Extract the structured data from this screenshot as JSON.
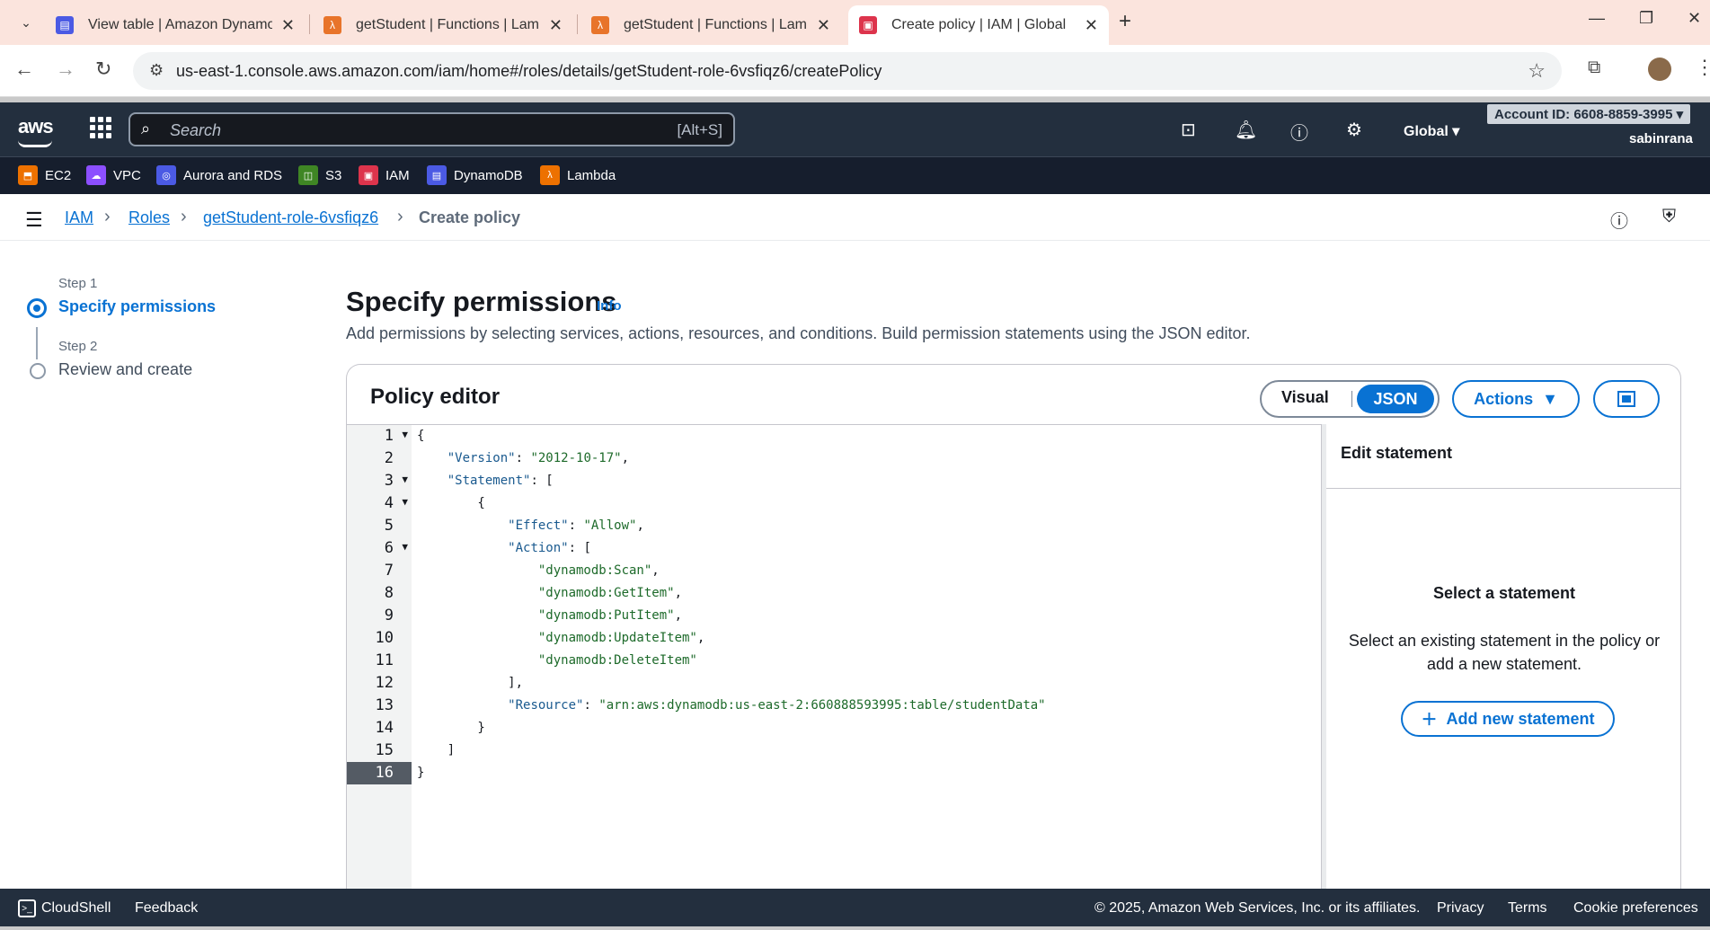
{
  "browser": {
    "tabs": [
      {
        "title": "View table | Amazon DynamoDB",
        "color": "#4b5ae4"
      },
      {
        "title": "getStudent | Functions | Lambda",
        "color": "#e8742a"
      },
      {
        "title": "getStudent | Functions | Lambda",
        "color": "#e8742a"
      },
      {
        "title": "Create policy | IAM | Global",
        "color": "#dd344c"
      }
    ],
    "url": "us-east-1.console.aws.amazon.com/iam/home#/roles/details/getStudent-role-6vsfiqz6/createPolicy"
  },
  "aws_nav": {
    "logo": "aws",
    "search_placeholder": "Search",
    "search_shortcut": "[Alt+S]",
    "region": "Global",
    "account": "Account ID: 6608-8859-3995",
    "username": "sabinrana"
  },
  "favorites": [
    {
      "label": "EC2",
      "color": "#ed7100"
    },
    {
      "label": "VPC",
      "color": "#8c4fff"
    },
    {
      "label": "Aurora and RDS",
      "color": "#4b5ae4"
    },
    {
      "label": "S3",
      "color": "#3f8624"
    },
    {
      "label": "IAM",
      "color": "#dd344c"
    },
    {
      "label": "DynamoDB",
      "color": "#4b5ae4"
    },
    {
      "label": "Lambda",
      "color": "#ed7100"
    }
  ],
  "breadcrumb": {
    "iam": "IAM",
    "roles": "Roles",
    "role": "getStudent-role-6vsfiqz6",
    "current": "Create policy"
  },
  "steps": [
    {
      "label": "Step 1",
      "name": "Specify permissions"
    },
    {
      "label": "Step 2",
      "name": "Review and create"
    }
  ],
  "page": {
    "title": "Specify permissions",
    "info": "Info",
    "description": "Add permissions by selecting services, actions, resources, and conditions. Build permission statements using the JSON editor."
  },
  "editor": {
    "title": "Policy editor",
    "visual_label": "Visual",
    "json_label": "JSON",
    "actions_label": "Actions",
    "active_line": 16,
    "lines": [
      {
        "n": "1",
        "text": "{"
      },
      {
        "n": "2",
        "text": "    \"Version\": \"2012-10-17\","
      },
      {
        "n": "3",
        "text": "    \"Statement\": ["
      },
      {
        "n": "4",
        "text": "        {"
      },
      {
        "n": "5",
        "text": "            \"Effect\": \"Allow\","
      },
      {
        "n": "6",
        "text": "            \"Action\": ["
      },
      {
        "n": "7",
        "text": "                \"dynamodb:Scan\","
      },
      {
        "n": "8",
        "text": "                \"dynamodb:GetItem\","
      },
      {
        "n": "9",
        "text": "                \"dynamodb:PutItem\","
      },
      {
        "n": "10",
        "text": "                \"dynamodb:UpdateItem\","
      },
      {
        "n": "11",
        "text": "                \"dynamodb:DeleteItem\""
      },
      {
        "n": "12",
        "text": "            ],"
      },
      {
        "n": "13",
        "text": "            \"Resource\": \"arn:aws:dynamodb:us-east-2:660888593995:table/studentData\""
      },
      {
        "n": "14",
        "text": "        }"
      },
      {
        "n": "15",
        "text": "    ]"
      },
      {
        "n": "16",
        "text": "}"
      }
    ]
  },
  "side_panel": {
    "title": "Edit statement",
    "select_title": "Select a statement",
    "select_text": "Select an existing statement in the policy or add a new statement.",
    "add_label": "Add new statement"
  },
  "footer": {
    "cloudshell": "CloudShell",
    "feedback": "Feedback",
    "copyright": "© 2025, Amazon Web Services, Inc. or its affiliates.",
    "privacy": "Privacy",
    "terms": "Terms",
    "cookies": "Cookie preferences"
  }
}
